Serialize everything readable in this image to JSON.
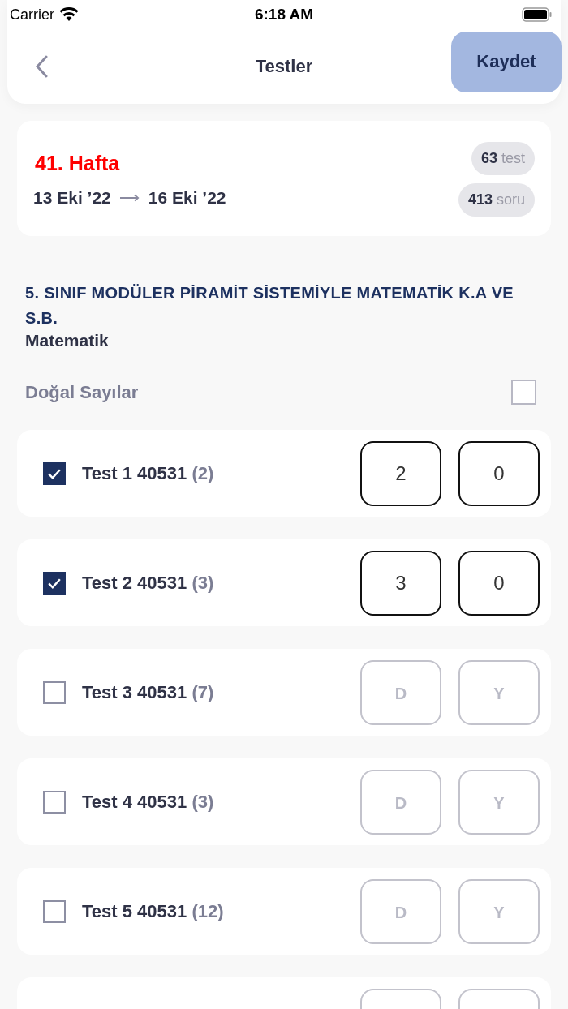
{
  "status_bar": {
    "carrier": "Carrier",
    "time": "6:18 AM"
  },
  "header": {
    "title": "Testler",
    "save_button": "Kaydet"
  },
  "week": {
    "title": "41. Hafta",
    "start": "13 Eki ’22",
    "end": "16 Eki ’22",
    "badges": [
      {
        "count": "63",
        "unit": "test"
      },
      {
        "count": "413",
        "unit": "soru"
      }
    ]
  },
  "book": {
    "title": "5. SINIF MODÜLER PİRAMİT SİSTEMİYLE MATEMATİK K.A VE S.B.",
    "subject": "Matematik"
  },
  "topic": {
    "label": "Doğal Sayılar",
    "checked": false
  },
  "tests": [
    {
      "kind": "test",
      "label": "Test 1 40531",
      "count": "(2)",
      "checked": true,
      "fields": [
        {
          "value": "2"
        },
        {
          "value": "0"
        }
      ]
    },
    {
      "kind": "test",
      "label": "Test 2 40531",
      "count": "(3)",
      "checked": true,
      "fields": [
        {
          "value": "3"
        },
        {
          "value": "0"
        }
      ]
    },
    {
      "kind": "test",
      "label": "Test 3 40531",
      "count": "(7)",
      "checked": false,
      "fields": [
        {
          "placeholder": "D"
        },
        {
          "placeholder": "Y"
        }
      ]
    },
    {
      "kind": "test",
      "label": "Test 4 40531",
      "count": "(3)",
      "checked": false,
      "fields": [
        {
          "placeholder": "D"
        },
        {
          "placeholder": "Y"
        }
      ]
    },
    {
      "kind": "test",
      "label": "Test 5 40531",
      "count": "(12)",
      "checked": false,
      "fields": [
        {
          "placeholder": "D"
        },
        {
          "placeholder": "Y"
        }
      ]
    },
    {
      "kind": "cut"
    }
  ]
}
